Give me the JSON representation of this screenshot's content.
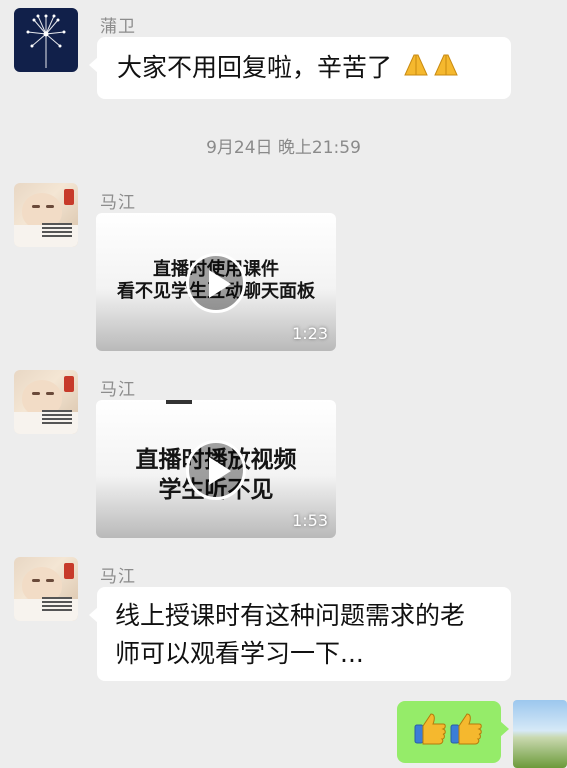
{
  "messages": [
    {
      "sender": "蒲卫",
      "avatar": "dandelion",
      "text": "大家不用回复啦，辛苦了",
      "emoji": "pray-hands-icon x2"
    },
    {
      "timestamp": "9月24日 晚上21:59"
    },
    {
      "sender": "马江",
      "avatar": "baby",
      "video": {
        "title_line1": "直播时使用课件",
        "title_line2": "看不见学生互动聊天面板",
        "duration": "1:23"
      }
    },
    {
      "sender": "马江",
      "avatar": "baby",
      "video": {
        "title_line1": "直播时播放视频",
        "title_line2": "学生听不见",
        "duration": "1:53"
      }
    },
    {
      "sender": "马江",
      "avatar": "baby",
      "text_line1": "线上授课时有这种问题需求的老",
      "text_line2": "师可以观看学习一下..."
    },
    {
      "sender": "me",
      "avatar": "landscape-photo",
      "emoji": "thumbs-up-icon x2"
    }
  ],
  "colors": {
    "background": "#ededed",
    "bubble_in": "#ffffff",
    "bubble_out": "#95ec69",
    "name": "#8c8c8c"
  }
}
